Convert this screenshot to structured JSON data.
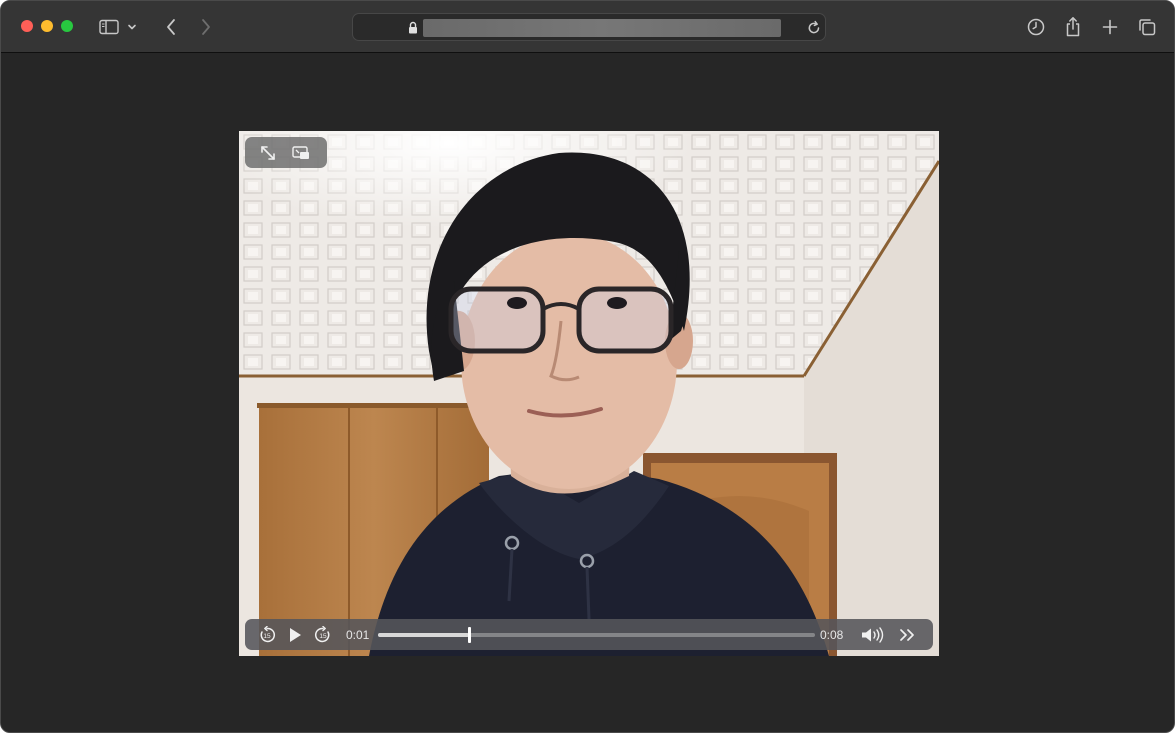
{
  "window": {
    "url_text": "",
    "traffic_lights": {
      "close": "#ff5f57",
      "minimize": "#febc2e",
      "zoom": "#28c840"
    }
  },
  "toolbar": {
    "icons": [
      "sidebar-icon",
      "chevron-down-icon",
      "back-icon",
      "forward-icon",
      "lock-icon",
      "reload-icon",
      "history-icon",
      "share-icon",
      "new-tab-icon",
      "tab-overview-icon"
    ]
  },
  "player": {
    "current_time": "0:01",
    "duration": "0:08",
    "progress": 0.208,
    "top_controls": [
      "fullscreen-icon",
      "picture-in-picture-icon"
    ],
    "bottom_controls": [
      "skip-back-15-icon",
      "play-icon",
      "skip-forward-15-icon",
      "volume-icon",
      "more-icon"
    ],
    "skip_back_label": "15",
    "skip_forward_label": "15"
  }
}
